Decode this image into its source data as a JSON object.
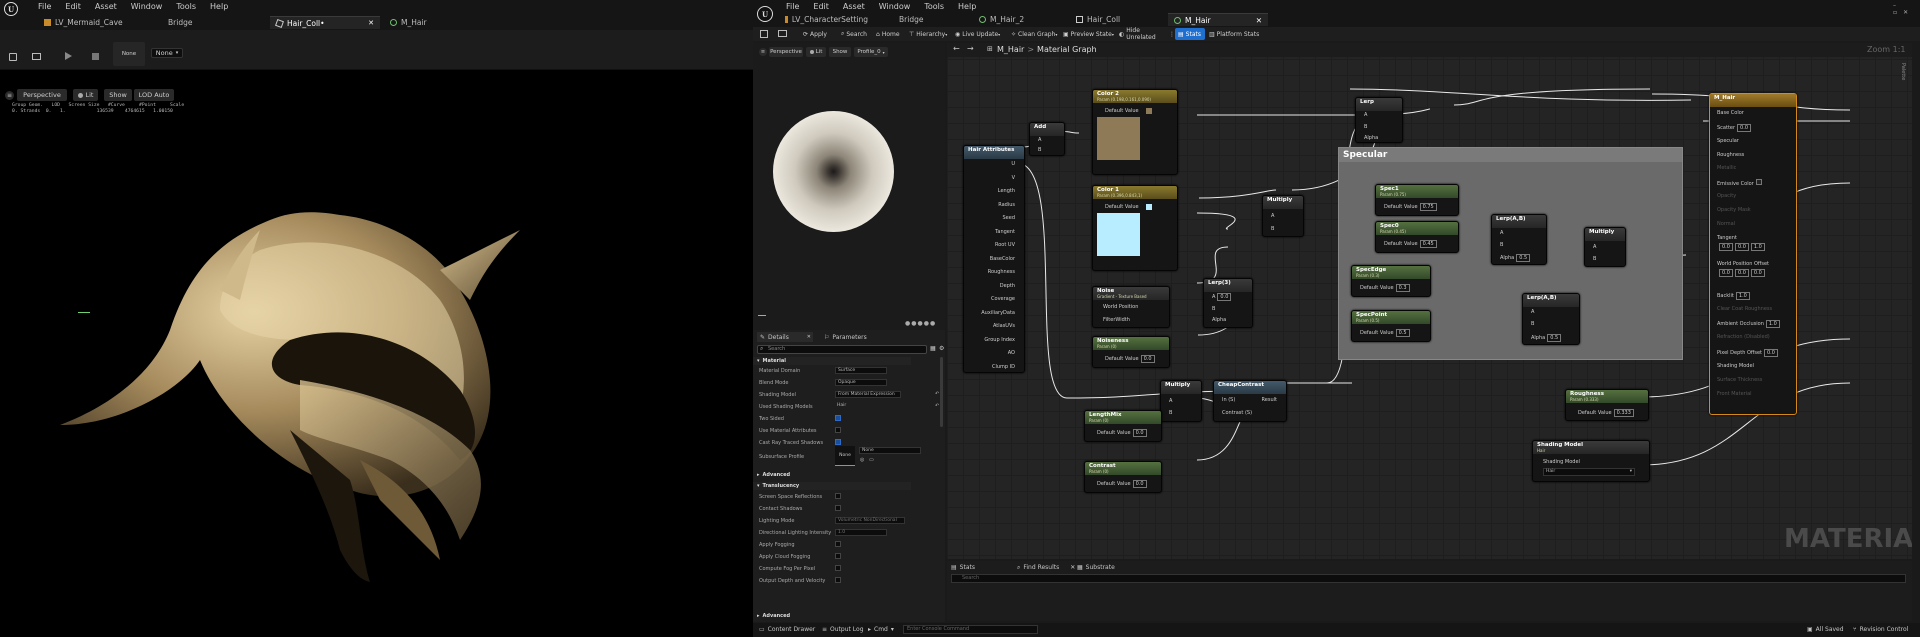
{
  "left": {
    "menu": [
      "File",
      "Edit",
      "Asset",
      "Window",
      "Tools",
      "Help"
    ],
    "tabs": [
      {
        "label": "LV_Mermaid_Cave"
      },
      {
        "label": "Bridge"
      },
      {
        "label": "Hair_Coll•"
      },
      {
        "label": "M_Hair"
      }
    ],
    "toolbar": {
      "none_label": "None",
      "none_dropdown": "None"
    },
    "viewport": {
      "perspective": "Perspective",
      "lit": "Lit",
      "show": "Show",
      "lod": "LOD Auto"
    },
    "stats": {
      "line1": "Group Geom.   LOD   Screen Size   #Curve     #Point     Scale",
      "line2": "0. Strands  0.   1.           136539    4764615   1.00150"
    }
  },
  "right": {
    "menu": [
      "File",
      "Edit",
      "Asset",
      "Window",
      "Tools",
      "Help"
    ],
    "tabs": [
      {
        "label": "LV_CharacterSetting"
      },
      {
        "label": "Bridge"
      },
      {
        "label": "M_Hair_2"
      },
      {
        "label": "Hair_Coll"
      },
      {
        "label": "M_Hair"
      }
    ],
    "toolbar": [
      "Apply",
      "Search",
      "Home",
      "Hierarchy",
      "Live Update",
      "Clean Graph",
      "Preview State",
      "Hide Unrelated",
      "Stats",
      "Platform Stats"
    ],
    "preview": {
      "perspective": "Perspective",
      "lit": "Lit",
      "show": "Show",
      "profile": "Profile_0"
    },
    "details": {
      "tab_details": "Details",
      "tab_params": "Parameters",
      "search_placeholder": "Search",
      "sec_material": "Material",
      "rows": [
        {
          "label": "Material Domain",
          "value": "Surface"
        },
        {
          "label": "Blend Mode",
          "value": "Opaque"
        },
        {
          "label": "Shading Model",
          "value": "From Material Expression"
        },
        {
          "label": "Used Shading Models",
          "value": "Hair"
        },
        {
          "label": "Two Sided",
          "value": ""
        },
        {
          "label": "Use Material Attributes",
          "value": ""
        },
        {
          "label": "Cast Ray Traced Shadows",
          "value": ""
        },
        {
          "label": "Subsurface Profile",
          "value": "None"
        }
      ],
      "subsurface_none": "None",
      "sec_advanced": "Advanced",
      "sec_translucency": "Translucency",
      "trows": [
        {
          "label": "Screen Space Reflections",
          "value": ""
        },
        {
          "label": "Contact Shadows",
          "value": ""
        },
        {
          "label": "Lighting Mode",
          "value": "Volumetric NonDirectional"
        },
        {
          "label": "Directional Lighting Intensity",
          "value": "1.0"
        },
        {
          "label": "Apply Fogging",
          "value": ""
        },
        {
          "label": "Apply Cloud Fogging",
          "value": ""
        },
        {
          "label": "Compute Fog Per Pixel",
          "value": ""
        },
        {
          "label": "Output Depth and Velocity",
          "value": ""
        }
      ],
      "sec_advanced2": "Advanced"
    },
    "graph": {
      "breadcrumb_asset": "M_Hair",
      "breadcrumb_sep": ">",
      "breadcrumb_page": "Material Graph",
      "zoom": "Zoom 1:1",
      "palette": "Palette",
      "watermark": "MATERIAL",
      "comment": "Specular",
      "nodes": {
        "hair_attr": {
          "title": "Hair Attributes",
          "pins": [
            "U",
            "V",
            "Length",
            "Radius",
            "Seed",
            "Tangent",
            "Root UV",
            "BaseColor",
            "Roughness",
            "Depth",
            "Coverage",
            "AuxiliaryData",
            "AtlasUVs",
            "Group Index",
            "AO",
            "Clump ID"
          ]
        },
        "add": {
          "title": "Add",
          "a": "A",
          "b": "B"
        },
        "color2": {
          "title": "Color 2",
          "sub": "Param (0.198,0.161,0.090)",
          "dv": "Default Value"
        },
        "color1": {
          "title": "Color 1",
          "sub": "Param (0.396,0.843,1)",
          "dv": "Default Value"
        },
        "noise": {
          "title": "Noise",
          "sub": "Gradient - Texture Based",
          "p1": "World Position",
          "p2": "FilterWidth"
        },
        "noiseness": {
          "title": "Noiseness",
          "sub": "Param (0)",
          "dv": "Default Value",
          "v": "0.0"
        },
        "lerp3": {
          "title": "Lerp(3)",
          "a": "A",
          "av": "0.0",
          "b": "B",
          "alpha": "Alpha"
        },
        "multiply1": {
          "title": "Multiply",
          "a": "A",
          "b": "B"
        },
        "lerp_top": {
          "title": "Lerp",
          "a": "A",
          "b": "B",
          "alpha": "Alpha"
        },
        "spec1": {
          "title": "Spec1",
          "sub": "Param (0.75)",
          "dv": "Default Value",
          "v": "0.75"
        },
        "spec0": {
          "title": "Spec0",
          "sub": "Param (0.45)",
          "dv": "Default Value",
          "v": "0.45"
        },
        "lerpab": {
          "title": "Lerp(A,B)",
          "a": "A",
          "b": "B",
          "alpha": "Alpha",
          "av": "0.5"
        },
        "multiply2": {
          "title": "Multiply",
          "a": "A",
          "b": "B"
        },
        "specedge": {
          "title": "SpecEdge",
          "sub": "Param (0.3)",
          "dv": "Default Value",
          "v": "0.3"
        },
        "specpoint": {
          "title": "SpecPoint",
          "sub": "Param (0.5)",
          "dv": "Default Value",
          "v": "0.5"
        },
        "lerpab2": {
          "title": "Lerp(A,B)",
          "a": "A",
          "b": "B",
          "alpha": "Alpha",
          "av": "0.5"
        },
        "multiply3": {
          "title": "Multiply",
          "a": "A",
          "b": "B"
        },
        "cheapcontrast": {
          "title": "CheapContrast",
          "in": "In (S)",
          "contrast": "Contrast (S)",
          "result": "Result"
        },
        "lengthmix": {
          "title": "LengthMix",
          "sub": "Param (0)",
          "dv": "Default Value",
          "v": "0.0"
        },
        "contrast": {
          "title": "Contrast",
          "sub": "Param (0)",
          "dv": "Default Value",
          "v": "0.0"
        },
        "roughness": {
          "title": "Roughness",
          "sub": "Param (0.333)",
          "dv": "Default Value",
          "v": "0.333"
        },
        "shadingmodel": {
          "title": "Shading Model",
          "sub": "Hair",
          "sm": "Shading Model",
          "v": "Hair"
        },
        "mhair": {
          "title": "M_Hair",
          "pins": [
            "Base Color",
            "Scatter",
            "Specular",
            "Roughness",
            "Metallic",
            "Emissive Color",
            "Opacity",
            "Opacity Mask",
            "Normal",
            "Tangent",
            "World Position Offset",
            "Backlit",
            "Clear Coat Roughness",
            "Ambient Occlusion",
            "Refraction (Disabled)",
            "Pixel Depth Offset",
            "Shading Model",
            "Surface Thickness",
            "Front Material"
          ],
          "scatter": "0.0",
          "backlit": "1.0",
          "pdo": "0.0",
          "tangent": [
            "0.0",
            "0.0",
            "1.0"
          ],
          "wpo": [
            "0.0",
            "0.0",
            "0.0"
          ]
        }
      }
    },
    "bottom": {
      "stats": "Stats",
      "find": "Find Results",
      "substrate": "Substrate",
      "search_placeholder": "Search"
    },
    "status": {
      "content_drawer": "Content Drawer",
      "output_log": "Output Log",
      "cmd": "Cmd",
      "console_placeholder": "Enter Console Command",
      "saved": "All Saved",
      "revision": "Revision Control"
    }
  },
  "colors": {
    "accent": "#1f6fd1",
    "bg": "#0d0d0d",
    "panel": "#1a1a1a",
    "color2_swatch": "#8f7a58",
    "color1_swatch": "#b8ecff",
    "output_node_border": "#d48a1a"
  }
}
